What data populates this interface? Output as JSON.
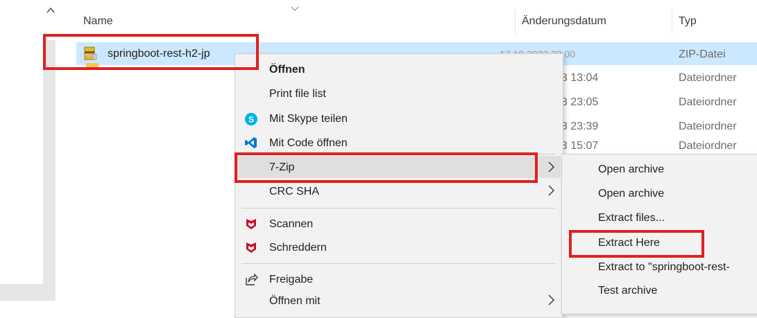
{
  "explorer": {
    "columns": {
      "name": "Name",
      "date": "Änderungsdatum",
      "type": "Typ"
    },
    "rows": [
      {
        "name": "springboot-rest-h2-jp",
        "date": "17.10.2023 22:00",
        "type": "ZIP-Datei"
      },
      {
        "date_visible": "23 13:04",
        "type": "Dateiordner"
      },
      {
        "date_visible": "23 23:05",
        "type": "Dateiordner"
      },
      {
        "date_visible": "23 23:39",
        "type": "Dateiordner"
      },
      {
        "date_visible": "23 15:07",
        "type": "Dateiordner"
      }
    ]
  },
  "context_menu": {
    "items": [
      {
        "label": "Öffnen",
        "bold": true
      },
      {
        "label": "Print file list"
      },
      {
        "label": "Mit Skype teilen",
        "icon": "skype-icon"
      },
      {
        "label": "Mit Code öffnen",
        "icon": "vscode-icon"
      },
      {
        "label": "7-Zip",
        "submenu": true
      },
      {
        "label": "CRC SHA",
        "submenu": true
      },
      {
        "label": "Scannen",
        "icon": "mcafee-icon"
      },
      {
        "label": "Schreddern",
        "icon": "mcafee-icon"
      },
      {
        "label": "Freigabe",
        "icon": "share-icon"
      },
      {
        "label": "Öffnen mit",
        "submenu": true
      }
    ]
  },
  "submenu_7zip": {
    "items": [
      {
        "label": "Open archive"
      },
      {
        "label": "Open archive"
      },
      {
        "label": "Extract files..."
      },
      {
        "label": "Extract Here"
      },
      {
        "label": "Extract to \"springboot-rest-"
      },
      {
        "label": "Test archive"
      }
    ]
  },
  "colors": {
    "selection": "#cce8ff",
    "menu_bg": "#f2f2f2",
    "annotation_red": "#e02020",
    "mcafee_red": "#c8102e",
    "skype_blue": "#00aff0",
    "vscode_blue": "#0078d4"
  }
}
